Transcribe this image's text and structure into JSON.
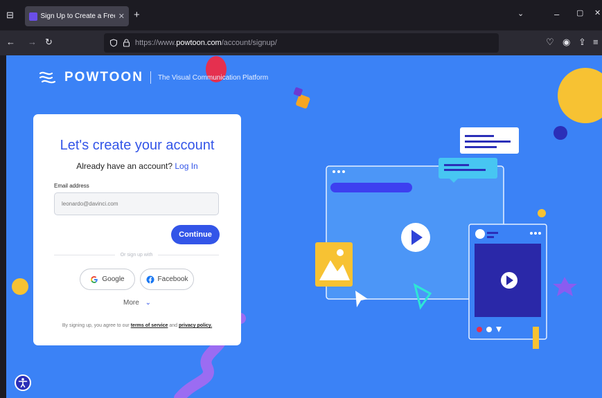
{
  "browser": {
    "tab_title": "Sign Up to Create a Free Powtoon",
    "url_prefix": "https://www.",
    "url_host": "powtoon.com",
    "url_path": "/account/signup/"
  },
  "header": {
    "brand": "POWTOON",
    "tagline": "The Visual Communication Platform"
  },
  "signup": {
    "title": "Let's create your account",
    "have_account": "Already have an account?",
    "login_link": "Log In",
    "email_label": "Email address",
    "email_placeholder": "leonardo@davinci.com",
    "continue_label": "Continue",
    "or_text": "Or sign up with",
    "google_label": "Google",
    "facebook_label": "Facebook",
    "more_label": "More",
    "terms_prefix": "By signing up, you agree to our",
    "terms_link": "terms of service",
    "and_text": "and",
    "privacy_link": "privacy policy."
  },
  "colors": {
    "page_bg": "#3b82f6",
    "accent": "#3355e8",
    "browser_bg": "#1c1b22"
  }
}
